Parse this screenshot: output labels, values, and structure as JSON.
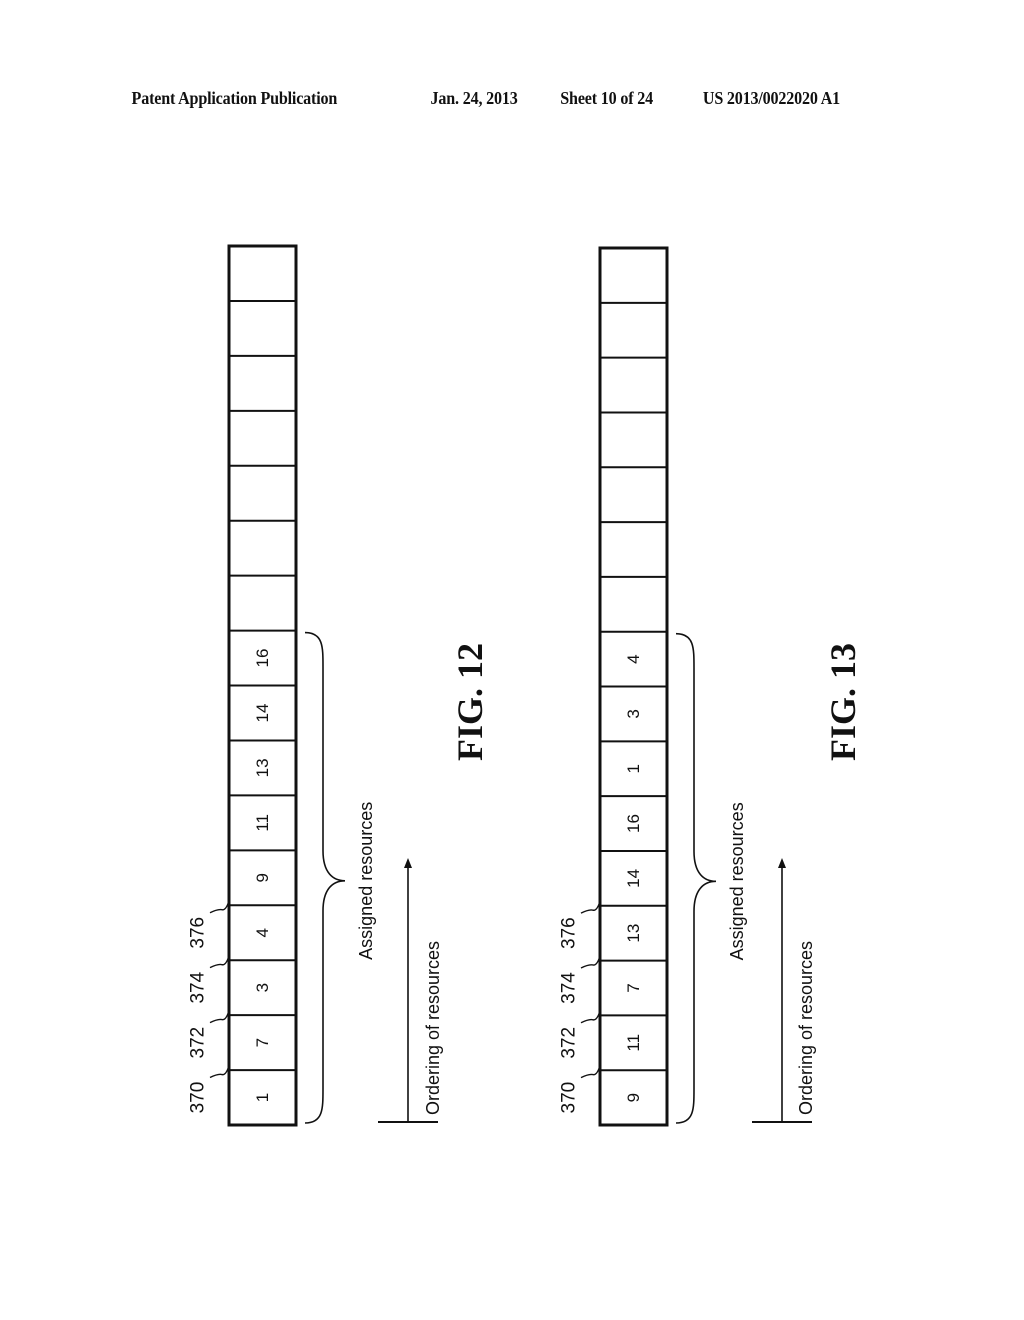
{
  "header": {
    "publication_type": "Patent Application Publication",
    "date": "Jan. 24, 2013",
    "sheet": "Sheet 10 of 24",
    "publication_number": "US 2013/0022020 A1"
  },
  "figures": [
    {
      "id": "fig12",
      "title": "FIG. 12",
      "total_cells": 16,
      "cells_bottom_to_top": [
        "1",
        "7",
        "3",
        "4",
        "9",
        "11",
        "13",
        "14",
        "16"
      ],
      "reference_labels": [
        "370",
        "372",
        "374",
        "376"
      ],
      "brace_label": "Assigned resources",
      "arrow_label": "Ordering of resources"
    },
    {
      "id": "fig13",
      "title": "FIG. 13",
      "total_cells": 16,
      "cells_bottom_to_top": [
        "9",
        "11",
        "7",
        "13",
        "14",
        "16",
        "1",
        "3",
        "4"
      ],
      "reference_labels": [
        "370",
        "372",
        "374",
        "376"
      ],
      "brace_label": "Assigned resources",
      "arrow_label": "Ordering of resources"
    }
  ]
}
